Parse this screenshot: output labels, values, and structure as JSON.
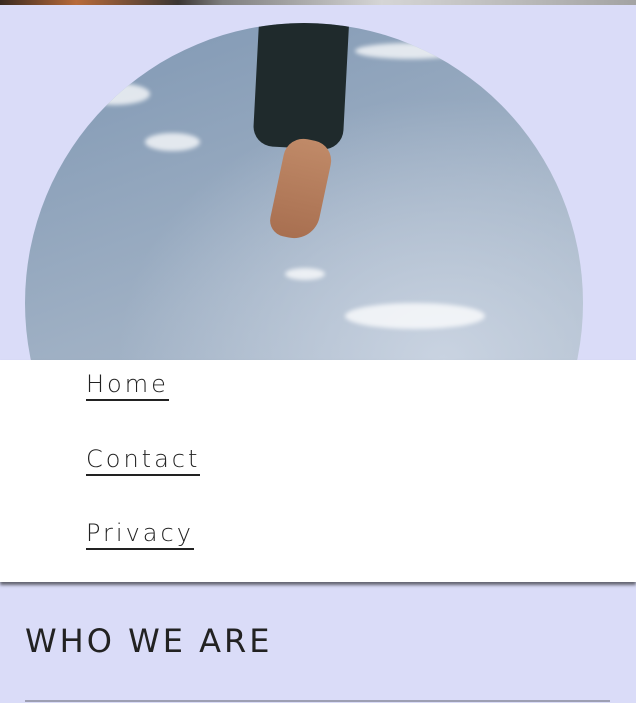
{
  "nav": {
    "items": [
      {
        "label": "Home"
      },
      {
        "label": "Contact"
      },
      {
        "label": "Privacy"
      }
    ]
  },
  "section": {
    "title": "WHO WE ARE"
  },
  "colors": {
    "page_background": "#dadcf8",
    "menu_background": "#ffffff",
    "text": "#222222"
  }
}
